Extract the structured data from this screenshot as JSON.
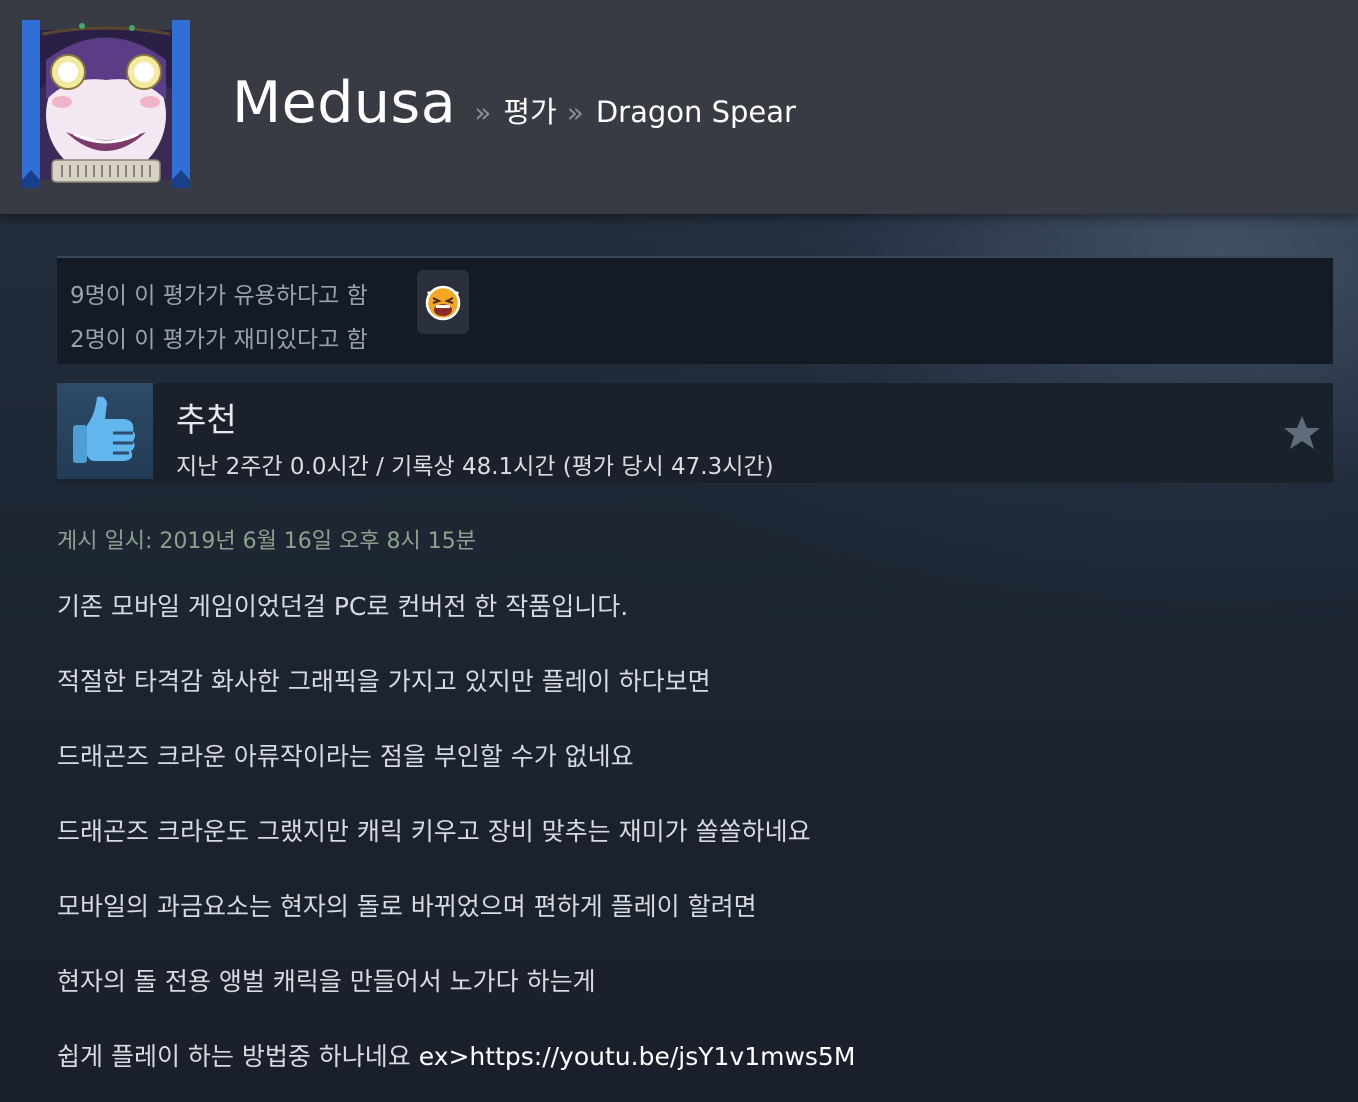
{
  "header": {
    "persona_name": "Medusa",
    "separator": "»",
    "crumb_reviews": "평가",
    "crumb_game": "Dragon Spear"
  },
  "ratings": {
    "helpful": "9명이 이 평가가 유용하다고 함",
    "funny": "2명이 이 평가가 재미있다고 함",
    "award_icon": "laughing-face-icon"
  },
  "recommendation": {
    "title": "추천",
    "hours": "지난 2주간 0.0시간 / 기록상 48.1시간 (평가 당시 47.3시간)",
    "thumb_icon": "thumbs-up-icon",
    "star_icon": "star-icon"
  },
  "posted": "게시 일시: 2019년 6월 16일 오후 8시 15분",
  "review": {
    "lines": [
      "기존 모바일 게임이었던걸 PC로 컨버전 한 작품입니다.",
      "적절한 타격감 화사한 그래픽을 가지고 있지만 플레이 하다보면",
      "드래곤즈 크라운 아류작이라는 점을 부인할 수가 없네요",
      "드래곤즈 크라운도 그랬지만 캐릭 키우고 장비 맞추는 재미가 쏠쏠하네요",
      "모바일의 과금요소는 현자의 돌로 바뀌었으며 편하게 플레이 할려면",
      "현자의 돌 전용 앵벌 캐릭을 만들어서 노가다 하는게"
    ],
    "last_line_text": "쉽게 플레이 하는 방법중 하나네요 ",
    "last_line_link": "ex>https://youtu.be/jsY1v1mws5M"
  },
  "colors": {
    "header_bg": "#383b43",
    "page_bg": "#1b2330",
    "thumb_blue": "#5fb3e8",
    "posted_green": "#8fa08a"
  }
}
